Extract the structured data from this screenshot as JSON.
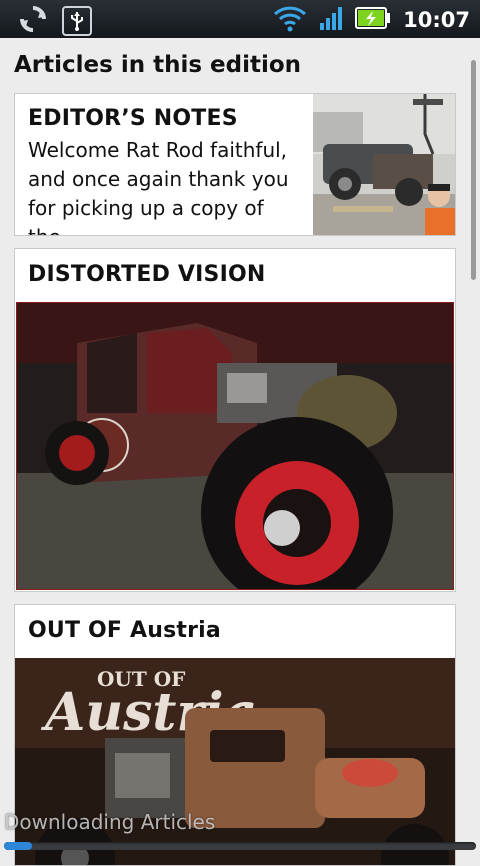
{
  "status_bar": {
    "time": "10:07",
    "icons": [
      "sync-icon",
      "usb-icon",
      "wifi-icon",
      "signal-icon",
      "battery-charging-icon"
    ]
  },
  "page": {
    "section_title": "Articles in this edition"
  },
  "articles": [
    {
      "title": "EDITOR’S NOTES",
      "excerpt_lines": [
        "Welcome Rat Rod faithful,",
        "and once again thank you",
        "for picking up a copy of the"
      ]
    },
    {
      "title": "DISTORTED VISION"
    },
    {
      "title": "OUT OF Austria",
      "image_text": [
        "OUT OF",
        "Austria"
      ]
    }
  ],
  "download": {
    "label": "Downloading Articles",
    "progress": 0.06
  },
  "colors": {
    "status_bar": "#1b1f24",
    "progress_fill": "#2e86d6",
    "background": "#ececec",
    "battery": "#7ed321"
  }
}
